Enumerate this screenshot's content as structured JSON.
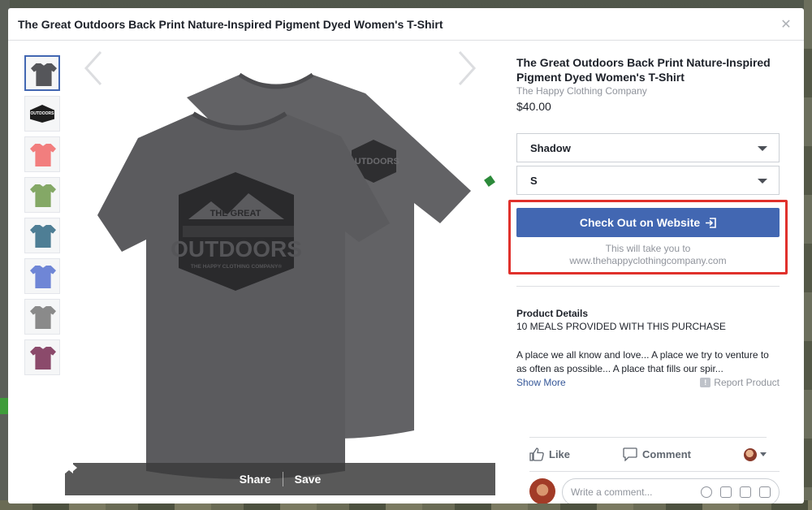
{
  "modal": {
    "title": "The Great Outdoors Back Print Nature-Inspired Pigment Dyed Women's T-Shirt",
    "close_icon": "close-icon"
  },
  "thumbnails": [
    {
      "color": "#55565a",
      "selected": true
    },
    {
      "color": "#ffffff",
      "badge": "OUTDOORS"
    },
    {
      "color": "#f27e7e"
    },
    {
      "color": "#84a866"
    },
    {
      "color": "#4e7e95"
    },
    {
      "color": "#6f86d6"
    },
    {
      "color": "#8a8a8a"
    },
    {
      "color": "#8b4a6b"
    }
  ],
  "image": {
    "front_text_top": "THE GREAT",
    "front_text_main": "OUTDOORS",
    "front_text_sub": "THE HAPPY CLOTHING COMPANY®",
    "shirt_color": "#5b5b5e"
  },
  "photo_bar": {
    "share_label": "Share",
    "save_label": "Save"
  },
  "product": {
    "title": "The Great Outdoors Back Print Nature-Inspired Pigment Dyed Women's T-Shirt",
    "seller": "The Happy Clothing Company",
    "price": "$40.00",
    "color_select": "Shadow",
    "size_select": "S",
    "checkout_label": "Check Out on Website",
    "checkout_note_line1": "This will take you to",
    "checkout_note_line2": "www.thehappyclothingcompany.com",
    "details_label": "Product Details",
    "meals": "10 MEALS PROVIDED WITH THIS PURCHASE",
    "description": "A place we all know and love... A place we try to venture to as often as possible... A place that fills our spir...",
    "show_more": "Show More",
    "report": "Report Product"
  },
  "actions": {
    "like": "Like",
    "comment": "Comment"
  },
  "comment_box": {
    "placeholder": "Write a comment..."
  },
  "colors": {
    "accent": "#4267b2",
    "highlight_border": "#e0312c"
  }
}
